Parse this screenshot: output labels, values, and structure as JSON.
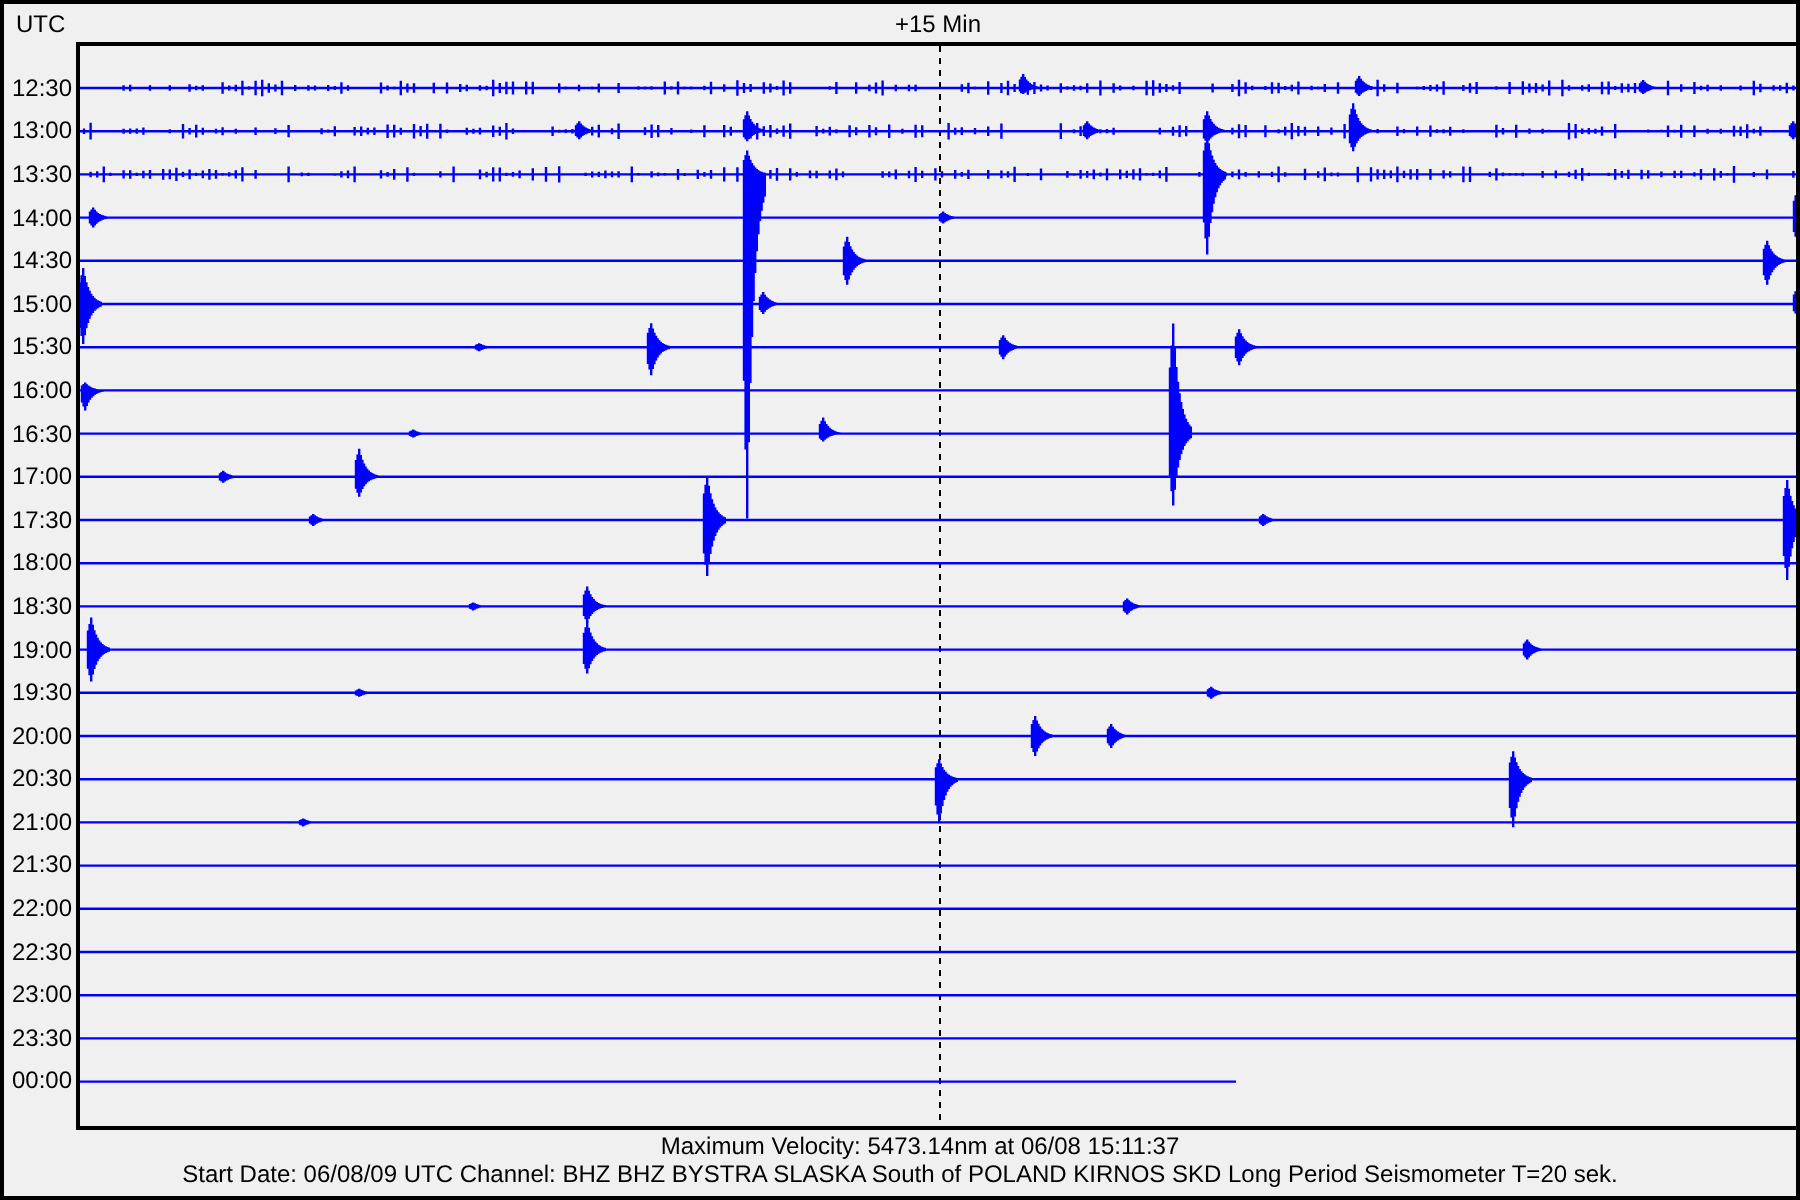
{
  "header": {
    "timezone": "UTC",
    "marker_label": "+15 Min"
  },
  "traces": [
    {
      "label": "12:30"
    },
    {
      "label": "13:00"
    },
    {
      "label": "13:30"
    },
    {
      "label": "14:00"
    },
    {
      "label": "14:30"
    },
    {
      "label": "15:00"
    },
    {
      "label": "15:30"
    },
    {
      "label": "16:00"
    },
    {
      "label": "16:30"
    },
    {
      "label": "17:00"
    },
    {
      "label": "17:30"
    },
    {
      "label": "18:00"
    },
    {
      "label": "18:30"
    },
    {
      "label": "19:00"
    },
    {
      "label": "19:30"
    },
    {
      "label": "20:00"
    },
    {
      "label": "20:30"
    },
    {
      "label": "21:00"
    },
    {
      "label": "21:30"
    },
    {
      "label": "22:00"
    },
    {
      "label": "22:30"
    },
    {
      "label": "23:00"
    },
    {
      "label": "23:30"
    },
    {
      "label": "00:00"
    }
  ],
  "footer": {
    "max_velocity": "Maximum Velocity: 5473.14nm at 06/08 15:11:37",
    "station_info": "Start Date: 06/08/09 UTC Channel: BHZ  BHZ  BYSTRA SLASKA South of POLAND  KIRNOS SKD Long Period Seismometer T=20 sek."
  }
}
